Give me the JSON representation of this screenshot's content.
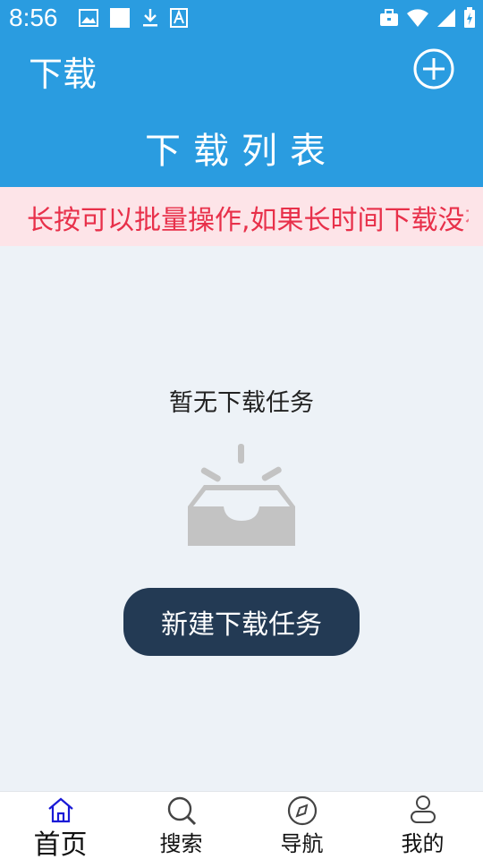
{
  "status_bar": {
    "time": "8:56",
    "left_icons": [
      "gallery-icon",
      "square-icon",
      "download-icon",
      "font-icon"
    ],
    "right_icons": [
      "briefcase-icon",
      "wifi-icon",
      "signal-icon",
      "battery-icon"
    ]
  },
  "header": {
    "title": "下载",
    "add_icon": "plus-circle-icon",
    "list_title": "下载列表"
  },
  "notice": {
    "text": "长按可以批量操作,如果长时间下载没有反应"
  },
  "empty_state": {
    "text": "暂无下载任务",
    "icon": "empty-inbox-icon"
  },
  "actions": {
    "new_task_label": "新建下载任务"
  },
  "bottom_nav": {
    "items": [
      {
        "label": "首页",
        "icon": "home-icon",
        "active": true
      },
      {
        "label": "搜索",
        "icon": "search-icon",
        "active": false
      },
      {
        "label": "导航",
        "icon": "compass-icon",
        "active": false
      },
      {
        "label": "我的",
        "icon": "profile-icon",
        "active": false
      }
    ]
  },
  "colors": {
    "primary": "#2a9ce0",
    "notice_bg": "#fde4e8",
    "notice_text": "#e8304a",
    "button_bg": "#233a54",
    "active_nav": "#1a1ad6"
  }
}
